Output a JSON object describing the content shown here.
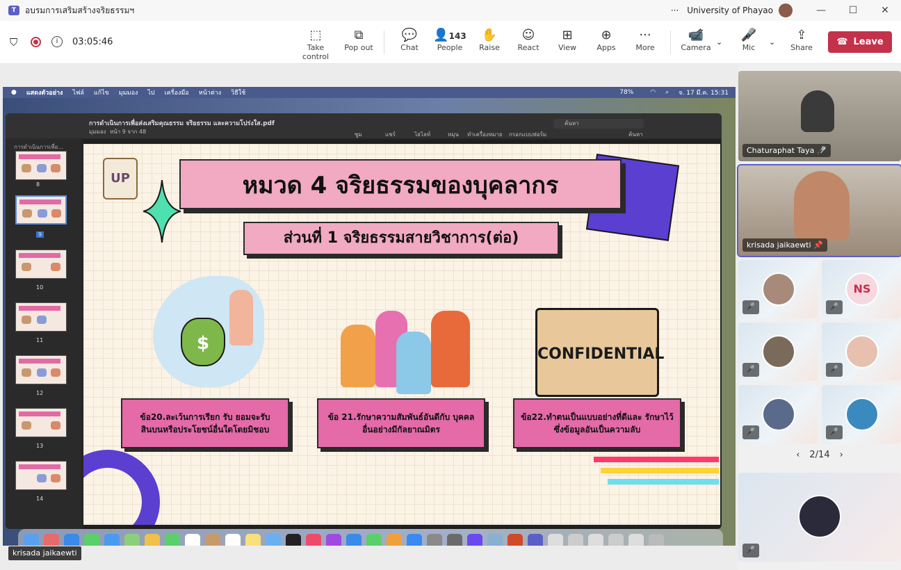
{
  "window": {
    "title": "อบรมการเสริมสร้างจริยธรรมฯ",
    "org": "University of Phayao",
    "more": "···"
  },
  "meeting": {
    "timer": "03:05:46"
  },
  "toolbar": {
    "take_control": "Take control",
    "pop_out": "Pop out",
    "chat": "Chat",
    "people": "People",
    "people_count": "143",
    "raise": "Raise",
    "react": "React",
    "view": "View",
    "apps": "Apps",
    "more": "More",
    "camera": "Camera",
    "mic": "Mic",
    "share": "Share",
    "leave": "Leave"
  },
  "mac": {
    "menu": [
      "แสดงตัวอย่าง",
      "ไฟล์",
      "แก้ไข",
      "มุมมอง",
      "ไป",
      "เครื่องมือ",
      "หน้าต่าง",
      "วิธีใช้"
    ],
    "battery": "78%",
    "clock": "จ. 17 มี.ค. 15:31"
  },
  "pdf": {
    "filename": "การดำเนินการเพื่อส่งเสริมคุณธรรม จริยธรรม และความโปร่งใส.pdf",
    "page_info": "หน้า 9 จาก 48",
    "sidebar_title": "การดำเนินการเพื่อ...",
    "view_label": "มุมมอง",
    "search_placeholder": "ค้นหา",
    "tools": [
      "ซูม",
      "แชร์",
      "ไฮไลท์",
      "หมุน",
      "ทำเครื่องหมาย",
      "กรอกแบบฟอร์ม",
      "ค้นหา"
    ],
    "thumbnails": [
      "8",
      "9",
      "10",
      "11",
      "12",
      "13",
      "14"
    ]
  },
  "slide": {
    "logo": "UP",
    "title": "หมวด 4 จริยธรรมของบุคลากร",
    "subtitle": "ส่วนที่ 1 จริยธรรมสายวิชาการ(ต่อ)",
    "confidential": "CONFIDENTIAL",
    "cards": [
      "ข้อ20.ละเว้นการเรียก รับ ยอมจะรับ สินบนหรือประโยชน์อื่นใดโดยมิชอบ",
      "ข้อ 21.รักษาความสัมพันธ์อันดีกับ บุคคลอื่นอย่างมีกัลยาณมิตร",
      "ข้อ22.ทำตนเป็นแบบอย่างที่ดีและ รักษาไว้ซึ่งข้อมูลอันเป็นความลับ"
    ]
  },
  "presenter_label": "krisada jaikaewti",
  "participants": {
    "video1": "Chaturaphat Taya",
    "video2": "krisada jaikaewti",
    "initials": "NS",
    "pager": "2/14"
  }
}
